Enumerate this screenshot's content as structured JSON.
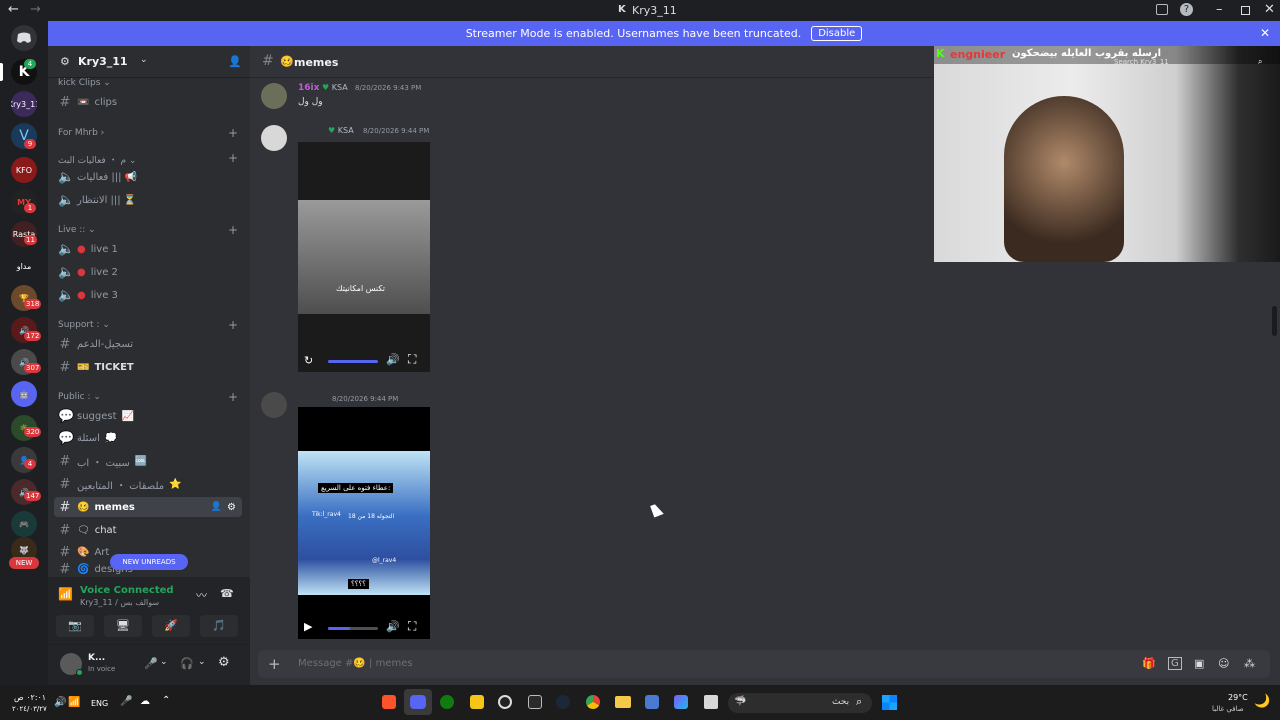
{
  "window": {
    "title": "Kry3_11"
  },
  "banner": {
    "text": "Streamer Mode is enabled. Usernames have been truncated.",
    "disable_label": "Disable"
  },
  "servers": {
    "badges": [
      "9",
      "1",
      "11",
      "318",
      "172",
      "307",
      "320",
      "4",
      "147",
      "NEW"
    ],
    "labels": [
      "Kry3_11",
      "KFO",
      "MY",
      "Rasta",
      "مداو"
    ]
  },
  "sidebar": {
    "server_name": "Kry3_11",
    "items": [
      {
        "type": "cat",
        "label": "kick Clips"
      },
      {
        "type": "ch",
        "label": "clips",
        "emoji": "📼"
      },
      {
        "type": "cat",
        "label": "For Mhrb"
      },
      {
        "type": "cat",
        "label": "م ・ فعاليات البث"
      },
      {
        "type": "voice",
        "label": "فعاليات ||| 📢"
      },
      {
        "type": "voice",
        "label": "الانتظار ||| ⏳"
      },
      {
        "type": "cat",
        "label": "Live :: "
      },
      {
        "type": "voice",
        "label": "live 1"
      },
      {
        "type": "voice",
        "label": "live 2"
      },
      {
        "type": "voice",
        "label": "live 3"
      },
      {
        "type": "cat",
        "label": "Support : "
      },
      {
        "type": "ch",
        "label": "تسجيل-الدعم"
      },
      {
        "type": "ch",
        "label": "TICKET",
        "emoji": "🎫"
      },
      {
        "type": "cat",
        "label": "Public : "
      },
      {
        "type": "ch",
        "label": "suggest",
        "emoji": "📈"
      },
      {
        "type": "ch",
        "label": "اسئلة",
        "emoji": "💭"
      },
      {
        "type": "ch",
        "label": "سبيت ・ اب",
        "emoji": "🆒"
      },
      {
        "type": "ch",
        "label": "ملصقات ・ المتابعين",
        "emoji": "⭐"
      },
      {
        "type": "ch",
        "label": "memes",
        "emoji": "🥴",
        "active": true
      },
      {
        "type": "ch",
        "label": "chat",
        "emoji": "🗨"
      },
      {
        "type": "ch",
        "label": "Art",
        "emoji": "🎨"
      },
      {
        "type": "ch",
        "label": "designs",
        "emoji": "🌀"
      }
    ],
    "new_unreads": "NEW UNREADS"
  },
  "voice": {
    "status": "Voice Connected",
    "location": "Kry3_11 / سوالف بس"
  },
  "user": {
    "name": "K...",
    "status": "In voice"
  },
  "chat": {
    "channel_name": "memes",
    "messages": [
      {
        "author": "16ix",
        "tag": "KSA",
        "time": "8/20/2026 9:43 PM",
        "text": "ول ول"
      },
      {
        "author": "",
        "tag": "KSA",
        "time": "8/20/2026 9:44 PM",
        "video_caption": "تكنس امكانيتك"
      },
      {
        "author": "",
        "tag": "",
        "time": "8/20/2026 9:44 PM",
        "video_caption": "عطاء فتوه على السريع:",
        "video_sub": "التجوله 18 من 18",
        "handle": "Tik:l_rav4",
        "handle2": "@l_rav4",
        "qmarks": "؟؟؟؟"
      }
    ],
    "message_placeholder": "Message #🥴 | memes"
  },
  "stream": {
    "channel": "engnieer",
    "title": "ارسله بقروب العايله بيضحكون",
    "search_placeholder": "Search Kry3_11"
  },
  "taskbar": {
    "time": "٠٢:٠١ ص",
    "date": "٢٠٢٤/٠٣/٢٧",
    "lang": "ENG",
    "search_label": "بحث",
    "weather": "29°C",
    "weather_desc": "صافي غالبا"
  }
}
